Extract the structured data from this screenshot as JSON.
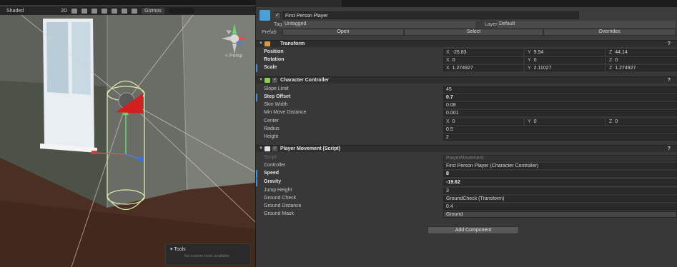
{
  "scene": {
    "toolbar": {
      "shading": "Shaded",
      "mode2d": "2D",
      "gizmos": "Gizmos"
    },
    "persp_label": "< Persp",
    "tools_panel": {
      "title": "▾ Tools",
      "message": "No custom tools available"
    }
  },
  "inspector": {
    "object_name": "First Person Player",
    "tag_label": "Tag",
    "tag_value": "Untagged",
    "layer_label": "Layer",
    "layer_value": "Default",
    "prefab_label": "Prefab",
    "prefab_buttons": [
      "Open",
      "Select",
      "Overrides"
    ],
    "transform": {
      "title": "Transform",
      "rows": [
        {
          "label": "Position",
          "x": "-26.83",
          "y": "9.54",
          "z": "44.14"
        },
        {
          "label": "Rotation",
          "x": "0",
          "y": "0",
          "z": "0"
        },
        {
          "label": "Scale",
          "x": "1.274927",
          "y": "2.11027",
          "z": "1.274927"
        }
      ]
    },
    "character_controller": {
      "title": "Character Controller",
      "rows": [
        {
          "label": "Slope Limit",
          "value": "45"
        },
        {
          "label": "Step Offset",
          "value": "0.7"
        },
        {
          "label": "Skin Width",
          "value": "0.08"
        },
        {
          "label": "Min Move Distance",
          "value": "0.001"
        }
      ],
      "center": {
        "label": "Center",
        "x": "0",
        "y": "0",
        "z": "0"
      },
      "rows2": [
        {
          "label": "Radius",
          "value": "0.5"
        },
        {
          "label": "Height",
          "value": "2"
        }
      ]
    },
    "player_movement": {
      "title": "Player Movement (Script)",
      "rows": [
        {
          "label": "Script",
          "value": "PlayerMovement"
        },
        {
          "label": "Controller",
          "value": "First Person Player (Character Controller)"
        },
        {
          "label": "Speed",
          "value": "8"
        },
        {
          "label": "Gravity",
          "value": "-19.62"
        },
        {
          "label": "Jump Height",
          "value": "3"
        },
        {
          "label": "Ground Check",
          "value": "GroundCheck (Transform)"
        },
        {
          "label": "Ground Distance",
          "value": "0.4"
        },
        {
          "label": "Ground Mask",
          "value": "Ground"
        }
      ]
    },
    "add_component": "Add Component"
  }
}
